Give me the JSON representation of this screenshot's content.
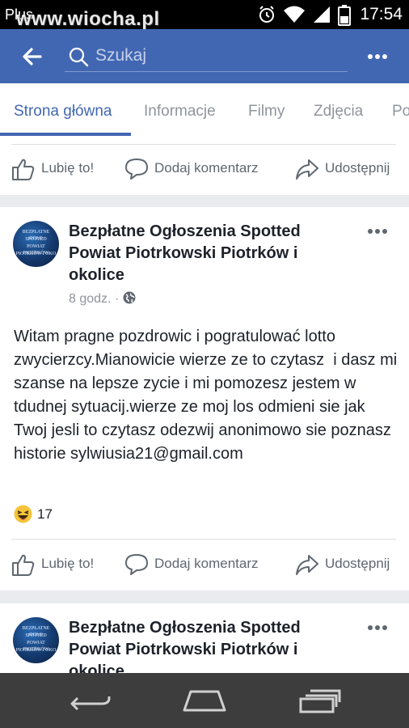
{
  "status_bar": {
    "carrier": "Plus",
    "watermark": "www.wiocha.pl",
    "time": "17:54"
  },
  "app_bar": {
    "back_icon": "arrow-left-icon",
    "search_placeholder": "Szukaj",
    "more_icon": "more-horizontal-icon",
    "color": "#4267b2"
  },
  "tabs": [
    {
      "label": "Strona główna",
      "active": true
    },
    {
      "label": "Informacje",
      "active": false
    },
    {
      "label": "Filmy",
      "active": false
    },
    {
      "label": "Zdjęcia",
      "active": false
    },
    {
      "label": "Po",
      "active": false
    }
  ],
  "actions": {
    "like": "Lubię to!",
    "comment": "Dodaj komentarz",
    "share": "Udostępnij"
  },
  "post": {
    "page_name": "Bezpłatne Ogłoszenia Spotted Powiat Piotrkowski Piotrków i okolice",
    "time": "8 godz.",
    "privacy_icon": "globe-icon",
    "avatar_text": [
      "BEZPŁATNE OGŁO",
      "SPOTTED",
      "POWIAT PIOTRKÓW",
      "PIOTRKÓW I OKO"
    ],
    "body": "Witam pragne pozdrowic i pogratulować lotto zwycierzcy.Mianowicie wierze ze to czytasz  i dasz mi szanse na lepsze zycie i mi pomozesz jestem w tdudnej sytuacij.wierze ze moj los odmieni sie jak Twoj jesli to czytasz odezwij anonimowo sie poznasz historie sylwiusia21@gmail.com",
    "reaction_icon": "haha-emoji-icon",
    "reaction_count": "17"
  },
  "next_post": {
    "page_name": "Bezpłatne Ogłoszenia Spotted Powiat Piotrkowski Piotrków i okolice"
  }
}
